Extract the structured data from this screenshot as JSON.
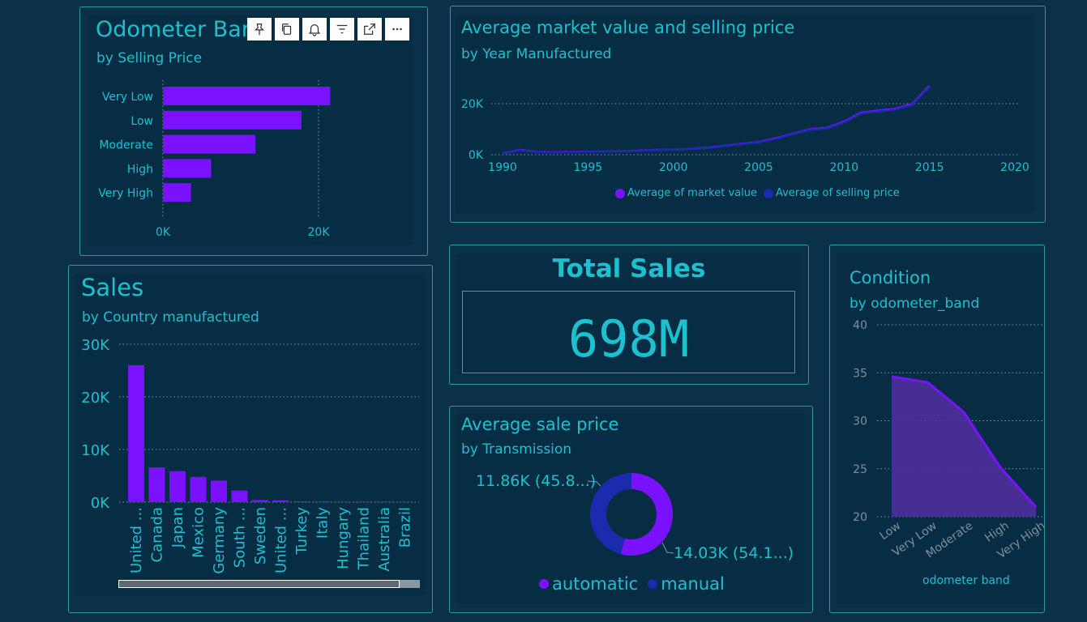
{
  "colors": {
    "purple": "#7a12ff",
    "navy": "#1a2cad",
    "teal": "#1cc0cf",
    "grid": "#7f9aa6"
  },
  "toolbar": [
    "pin-icon",
    "copy-icon",
    "bell-icon",
    "filter-icon",
    "expand-icon",
    "more-icon"
  ],
  "odometer_panel": {
    "title": "Odometer Band",
    "subtitle": "by Selling Price"
  },
  "market_panel": {
    "title": "Average market value and selling price",
    "subtitle": "by Year Manufactured",
    "legend": [
      "Average of market value",
      "Average of selling price"
    ]
  },
  "sales_panel": {
    "title": "Sales",
    "subtitle": "by Country manufactured"
  },
  "kpi": {
    "title": "Total Sales",
    "value": "698M"
  },
  "avg_sale_panel": {
    "title": "Average sale price",
    "subtitle": "by Transmission",
    "label_manual": "11.86K (45.8...)",
    "label_automatic": "14.03K (54.1...)",
    "legend": [
      "automatic",
      "manual"
    ]
  },
  "condition_panel": {
    "title": "Condition",
    "subtitle": "by odometer_band",
    "xlabel": "odometer band"
  },
  "chart_data": [
    {
      "id": "odometer",
      "type": "bar",
      "orientation": "horizontal",
      "title": "Odometer Band",
      "subtitle": "by Selling Price",
      "categories": [
        "Very Low",
        "Low",
        "Moderate",
        "High",
        "Very High"
      ],
      "values": [
        21500,
        17800,
        11900,
        6200,
        3600
      ],
      "xlim": [
        0,
        20000
      ],
      "xticks": [
        "0K",
        "20K"
      ]
    },
    {
      "id": "market",
      "type": "line",
      "title": "Average market value and selling price",
      "subtitle": "by Year Manufactured",
      "xlim": [
        1990,
        2020
      ],
      "xticks": [
        "1990",
        "1995",
        "2000",
        "2005",
        "2010",
        "2015",
        "2020"
      ],
      "ylim": [
        0,
        20000
      ],
      "yticks": [
        "0K",
        "20K"
      ],
      "series": [
        {
          "name": "Average of market value",
          "x": [
            1990,
            1991,
            1992,
            1993,
            1994,
            1995,
            1996,
            1997,
            1998,
            1999,
            2000,
            2001,
            2002,
            2003,
            2004,
            2005,
            2006,
            2007,
            2008,
            2009,
            2010,
            2011,
            2012,
            2013,
            2014,
            2015
          ],
          "values": [
            500,
            1900,
            1100,
            1000,
            1100,
            1200,
            1300,
            1400,
            1600,
            1900,
            2000,
            2300,
            2800,
            3500,
            4300,
            5000,
            6500,
            8200,
            10000,
            10600,
            13000,
            16500,
            17300,
            18000,
            20000,
            27000
          ]
        },
        {
          "name": "Average of selling price",
          "x": [
            1990,
            1991,
            1992,
            1993,
            1994,
            1995,
            1996,
            1997,
            1998,
            1999,
            2000,
            2001,
            2002,
            2003,
            2004,
            2005,
            2006,
            2007,
            2008,
            2009,
            2010,
            2011,
            2012,
            2013,
            2014,
            2015
          ],
          "values": [
            400,
            1700,
            1000,
            900,
            1000,
            1100,
            1200,
            1300,
            1500,
            1800,
            1900,
            2200,
            2600,
            3300,
            4100,
            4800,
            6200,
            8000,
            9700,
            10300,
            12600,
            16100,
            16900,
            17600,
            19600,
            26500
          ]
        }
      ]
    },
    {
      "id": "sales",
      "type": "bar",
      "title": "Sales",
      "subtitle": "by Country manufactured",
      "categories": [
        "United ...",
        "Canada",
        "Japan",
        "Mexico",
        "Germany",
        "South ...",
        "Sweden",
        "United ...",
        "Turkey",
        "Italy",
        "Hungary",
        "Thailand",
        "Australia",
        "Brazil"
      ],
      "values": [
        26000,
        6600,
        5900,
        4800,
        4100,
        2200,
        400,
        350,
        150,
        130,
        120,
        110,
        100,
        90
      ],
      "ylim": [
        0,
        30000
      ],
      "yticks": [
        "0K",
        "10K",
        "20K",
        "30K"
      ]
    },
    {
      "id": "transmission",
      "type": "pie",
      "donut": true,
      "title": "Average sale price",
      "subtitle": "by Transmission",
      "categories": [
        "automatic",
        "manual"
      ],
      "values": [
        14030,
        11860
      ]
    },
    {
      "id": "condition",
      "type": "area",
      "title": "Condition",
      "subtitle": "by odometer_band",
      "xlabel": "odometer band",
      "categories": [
        "Low",
        "Very Low",
        "Moderate",
        "High",
        "Very High"
      ],
      "values": [
        34.6,
        34.0,
        30.9,
        25.2,
        21.0
      ],
      "ylim": [
        20,
        40
      ],
      "yticks": [
        "20",
        "25",
        "30",
        "35",
        "40"
      ]
    }
  ]
}
